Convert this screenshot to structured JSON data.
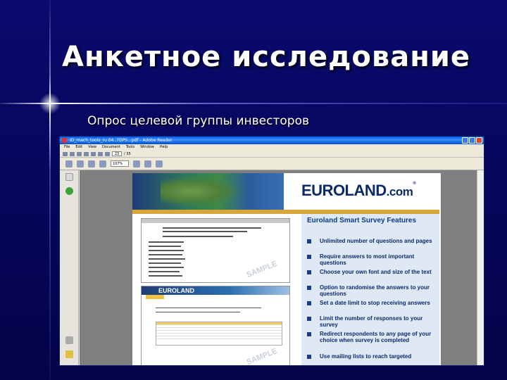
{
  "slide": {
    "title": "Анкетное исследование",
    "subtitle": "Опрос целевой группы инвесторов"
  },
  "window": {
    "title": "ID_mach_tools_ru 04..7DPS...pdf - Adobe Reader",
    "menu": [
      "File",
      "Edit",
      "View",
      "Document",
      "Tools",
      "Window",
      "Help"
    ],
    "page_number": "23",
    "page_total": "/ 35",
    "zoom": "107%"
  },
  "document": {
    "logo_text": "EUROLAND",
    "logo_suffix": ".com",
    "logo_mark": "®",
    "panel_title": "Euroland Smart Survey Features",
    "features": [
      "Unlimited number of questions and pages",
      "Require answers to most important questions",
      "Choose your own font and size of the text",
      "Option to randomise the answers to your questions",
      "Set a date limit to stop receiving answers",
      "Limit the number of responses to your survey",
      "Redirect respondents to any page of your choice when survey is completed",
      "Use mailing lists to reach targeted"
    ],
    "watermark": "SAMPLE",
    "thumb2_logo": "EUROLAND"
  }
}
